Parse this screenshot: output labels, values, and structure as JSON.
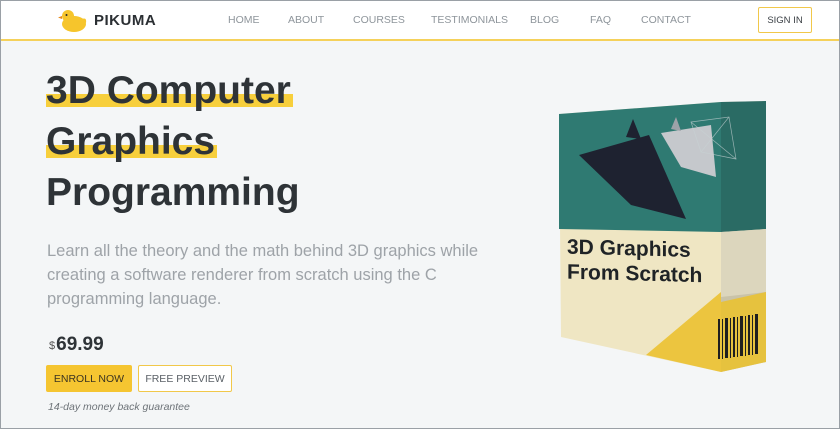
{
  "brand": {
    "name": "PIKUMA"
  },
  "nav": {
    "items": [
      "HOME",
      "ABOUT",
      "COURSES",
      "TESTIMONIALS",
      "BLOG",
      "FAQ",
      "CONTACT"
    ],
    "signin_label": "SIGN IN"
  },
  "hero": {
    "title_lines": [
      "3D Computer",
      "Graphics",
      "Programming"
    ],
    "lead": "Learn all the theory and the math behind 3D graphics while creating a software renderer from scratch using the C programming language.",
    "currency": "$",
    "price": "69.99",
    "enroll_label": "ENROLL NOW",
    "preview_label": "FREE PREVIEW",
    "guarantee": "14-day money back guarantee"
  },
  "product": {
    "box_title_line1": "3D Graphics",
    "box_title_line2": "From Scratch"
  },
  "colors": {
    "accent": "#f5c531",
    "highlight": "#f7cf3c",
    "box_teal": "#2f7a72",
    "box_cream": "#efe6c3"
  }
}
